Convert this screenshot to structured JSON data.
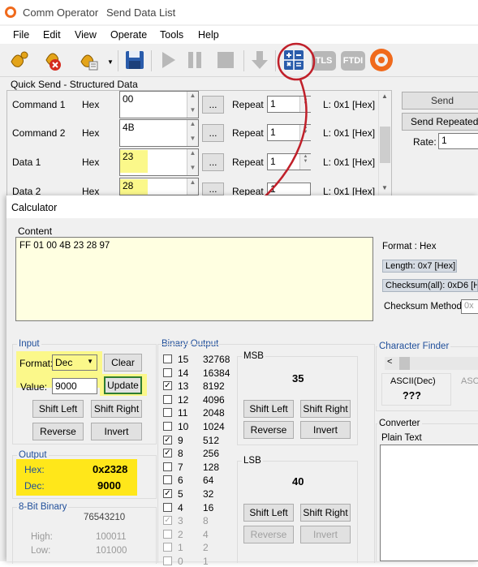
{
  "app": {
    "title": "Comm Operator",
    "subtitle": "Send Data List"
  },
  "menu": [
    "File",
    "Edit",
    "View",
    "Operate",
    "Tools",
    "Help"
  ],
  "toolbar": {
    "tls": "TLS",
    "ftdi": "FTDI"
  },
  "quick_send": {
    "title": "Quick Send - Structured Data",
    "rows": [
      {
        "name": "Command 1",
        "fmt": "Hex",
        "value": "00",
        "repeat": "Repeat",
        "count": "1",
        "len": "L:  0x1 [Hex]"
      },
      {
        "name": "Command 2",
        "fmt": "Hex",
        "value": "4B",
        "repeat": "Repeat",
        "count": "1",
        "len": "L:  0x1 [Hex]"
      },
      {
        "name": "Data 1",
        "fmt": "Hex",
        "value": "23",
        "repeat": "Repeat",
        "count": "1",
        "len": "L:  0x1 [Hex]"
      },
      {
        "name": "Data 2",
        "fmt": "Hex",
        "value": "28",
        "repeat": "Repeat",
        "count": "1",
        "len": "L:  0x1 [Hex]"
      }
    ],
    "ellipsis": "...",
    "send": "Send",
    "send_repeated": "Send Repeatedly",
    "rate_label": "Rate:",
    "rate_value": "1"
  },
  "calculator": {
    "title": "Calculator",
    "content_label": "Content",
    "content_value": "FF 01 00 4B 23 28 97",
    "format_info": "Format : Hex",
    "length": "Length:  0x7 [Hex]",
    "checksum_all": "Checksum(all):  0xD6 [H",
    "checksum_method": "Checksum Method:",
    "checksum_method_value": "0x",
    "input": {
      "title": "Input",
      "format_label": "Format:",
      "format_value": "Dec",
      "clear": "Clear",
      "value_label": "Value:",
      "value": "9000",
      "update": "Update",
      "shift_left": "Shift Left",
      "shift_right": "Shift Right",
      "reverse": "Reverse",
      "invert": "Invert"
    },
    "output": {
      "title": "Output",
      "hex_label": "Hex:",
      "hex_value": "0x2328",
      "dec_label": "Dec:",
      "dec_value": "9000"
    },
    "eight_bit": {
      "title": "8-Bit Binary",
      "bits_header": "76543210",
      "high_label": "High:",
      "high_value": "100011",
      "low_label": "Low:",
      "low_value": "101000"
    },
    "binary_output": {
      "title": "Binary Output",
      "bits": [
        {
          "bit": "15",
          "value": "32768",
          "checked": false,
          "dim": false
        },
        {
          "bit": "14",
          "value": "16384",
          "checked": false,
          "dim": false
        },
        {
          "bit": "13",
          "value": "8192",
          "checked": true,
          "dim": false
        },
        {
          "bit": "12",
          "value": "4096",
          "checked": false,
          "dim": false
        },
        {
          "bit": "11",
          "value": "2048",
          "checked": false,
          "dim": false
        },
        {
          "bit": "10",
          "value": "1024",
          "checked": false,
          "dim": false
        },
        {
          "bit": "9",
          "value": "512",
          "checked": true,
          "dim": false
        },
        {
          "bit": "8",
          "value": "256",
          "checked": true,
          "dim": false
        },
        {
          "bit": "7",
          "value": "128",
          "checked": false,
          "dim": false
        },
        {
          "bit": "6",
          "value": "64",
          "checked": false,
          "dim": false
        },
        {
          "bit": "5",
          "value": "32",
          "checked": true,
          "dim": false
        },
        {
          "bit": "4",
          "value": "16",
          "checked": false,
          "dim": false
        },
        {
          "bit": "3",
          "value": "8",
          "checked": true,
          "dim": true
        },
        {
          "bit": "2",
          "value": "4",
          "checked": false,
          "dim": true
        },
        {
          "bit": "1",
          "value": "2",
          "checked": false,
          "dim": true
        },
        {
          "bit": "0",
          "value": "1",
          "checked": false,
          "dim": true
        }
      ]
    },
    "msb": {
      "title": "MSB",
      "value": "35",
      "shift_left": "Shift Left",
      "shift_right": "Shift Right",
      "reverse": "Reverse",
      "invert": "Invert"
    },
    "lsb": {
      "title": "LSB",
      "value": "40",
      "shift_left": "Shift Left",
      "shift_right": "Shift Right",
      "reverse": "Reverse",
      "invert": "Invert"
    },
    "char_finder": {
      "title": "Character Finder",
      "ascii_label": "ASCII(Dec)",
      "ascii_value": "???",
      "ascii_label2": "ASC"
    },
    "converter": {
      "title": "Converter",
      "plain_text": "Plain Text"
    }
  },
  "colors": {
    "highlight": "#fbf88a",
    "accent_blue": "#1f4e9a",
    "annotation_red": "#c0202a",
    "output_highlight": "#ffe71a"
  }
}
